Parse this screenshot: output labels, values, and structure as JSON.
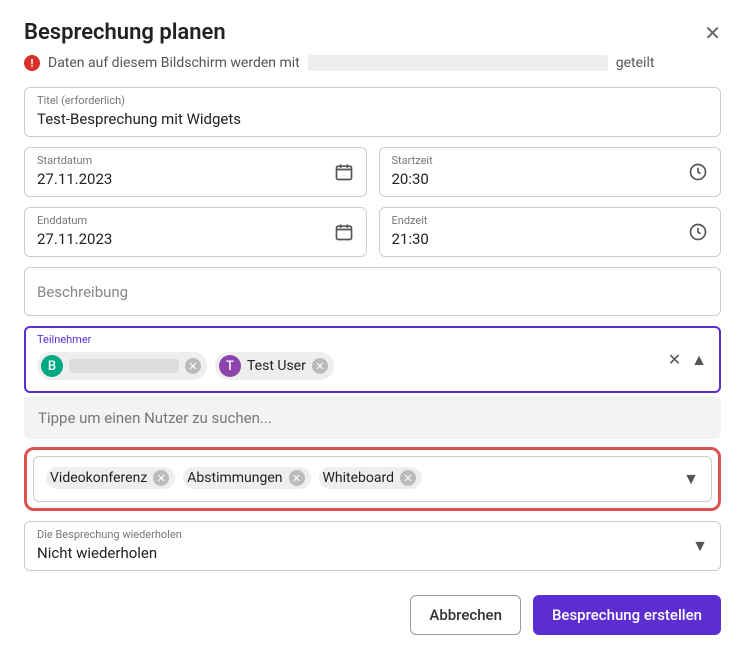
{
  "header": {
    "title": "Besprechung planen"
  },
  "warning": {
    "prefix": "Daten auf diesem Bildschirm werden mit",
    "suffix": "geteilt"
  },
  "title_field": {
    "label": "Titel (erforderlich)",
    "value": "Test-Besprechung mit Widgets"
  },
  "start_date": {
    "label": "Startdatum",
    "value": "27.11.2023"
  },
  "start_time": {
    "label": "Startzeit",
    "value": "20:30"
  },
  "end_date": {
    "label": "Enddatum",
    "value": "27.11.2023"
  },
  "end_time": {
    "label": "Endzeit",
    "value": "21:30"
  },
  "description": {
    "placeholder": "Beschreibung"
  },
  "participants": {
    "label": "Teilnehmer",
    "chips": [
      {
        "initial": "B",
        "color": "green",
        "name": ""
      },
      {
        "initial": "T",
        "color": "purple",
        "name": "Test User"
      }
    ],
    "search_hint": "Tippe um einen Nutzer zu suchen..."
  },
  "widgets": {
    "chips": [
      "Videokonferenz",
      "Abstimmungen",
      "Whiteboard"
    ]
  },
  "repeat": {
    "label": "Die Besprechung wiederholen",
    "value": "Nicht wiederholen"
  },
  "footer": {
    "cancel": "Abbrechen",
    "create": "Besprechung erstellen"
  }
}
